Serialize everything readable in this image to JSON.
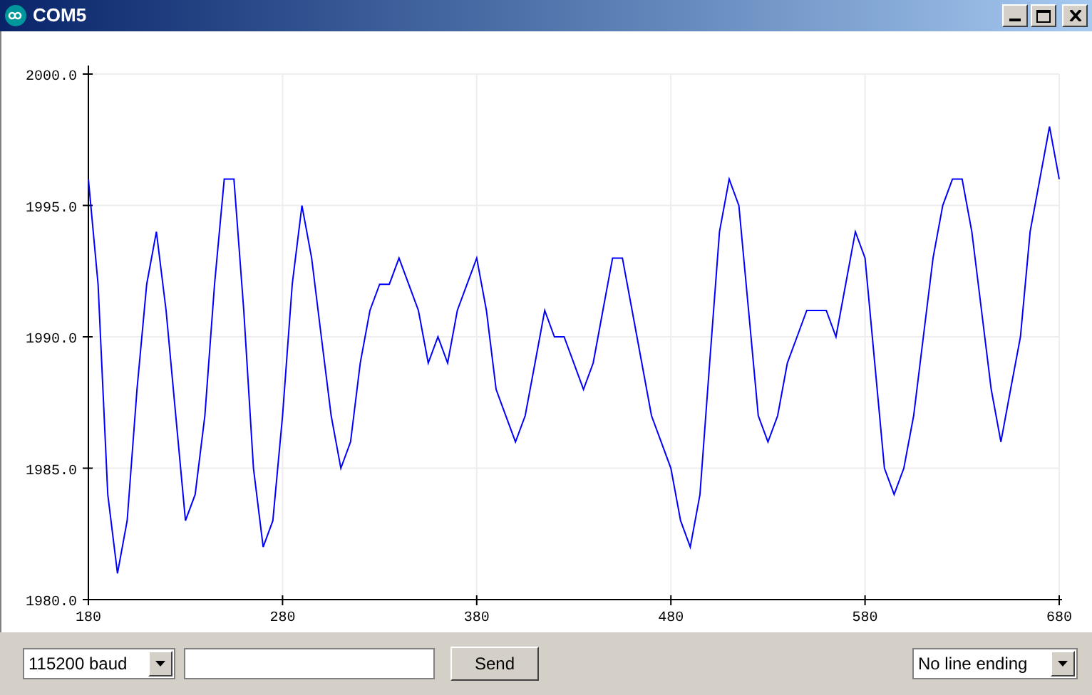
{
  "window": {
    "title": "COM5"
  },
  "plot": {
    "chart_data": {
      "type": "line",
      "grid": true,
      "xlim": [
        180,
        680
      ],
      "ylim": [
        1980,
        2000
      ],
      "xticks": [
        180,
        280,
        380,
        480,
        580,
        680
      ],
      "yticks": [
        {
          "value": 1980,
          "label": "1980.0"
        },
        {
          "value": 1985,
          "label": "1985.0"
        },
        {
          "value": 1990,
          "label": "1990.0"
        },
        {
          "value": 1995,
          "label": "1995.0"
        },
        {
          "value": 2000,
          "label": "2000.0"
        }
      ],
      "x": [
        180,
        185,
        190,
        195,
        200,
        205,
        210,
        215,
        220,
        225,
        230,
        235,
        240,
        245,
        250,
        255,
        260,
        265,
        270,
        275,
        280,
        285,
        290,
        295,
        300,
        305,
        310,
        315,
        320,
        325,
        330,
        335,
        340,
        345,
        350,
        355,
        360,
        365,
        370,
        375,
        380,
        385,
        390,
        395,
        400,
        405,
        410,
        415,
        420,
        425,
        430,
        435,
        440,
        445,
        450,
        455,
        460,
        465,
        470,
        475,
        480,
        485,
        490,
        495,
        500,
        505,
        510,
        515,
        520,
        525,
        530,
        535,
        540,
        545,
        550,
        555,
        560,
        565,
        570,
        575,
        580,
        585,
        590,
        595,
        600,
        605,
        610,
        615,
        620,
        625,
        630,
        635,
        640,
        645,
        650,
        655,
        660,
        665,
        670,
        675,
        680
      ],
      "series": [
        {
          "color": "#0000ff",
          "values": [
            1996,
            1992,
            1984,
            1981,
            1983,
            1988,
            1992,
            1994,
            1991,
            1987,
            1983,
            1984,
            1987,
            1992,
            1996,
            1996,
            1991,
            1985,
            1982,
            1983,
            1987,
            1992,
            1995,
            1993,
            1990,
            1987,
            1985,
            1986,
            1989,
            1991,
            1992,
            1992,
            1993,
            1992,
            1991,
            1989,
            1990,
            1989,
            1991,
            1992,
            1993,
            1991,
            1988,
            1987,
            1986,
            1987,
            1989,
            1991,
            1990,
            1990,
            1989,
            1988,
            1989,
            1991,
            1993,
            1993,
            1991,
            1989,
            1987,
            1986,
            1985,
            1983,
            1982,
            1984,
            1989,
            1994,
            1996,
            1995,
            1991,
            1987,
            1986,
            1987,
            1989,
            1990,
            1991,
            1991,
            1991,
            1990,
            1992,
            1994,
            1993,
            1989,
            1985,
            1984,
            1985,
            1987,
            1990,
            1993,
            1995,
            1996,
            1996,
            1994,
            1991,
            1988,
            1986,
            1988,
            1990,
            1994,
            1996,
            1998,
            1996
          ]
        }
      ]
    }
  },
  "controls": {
    "baud": "115200 baud",
    "send": "Send",
    "line_ending": "No line ending"
  }
}
